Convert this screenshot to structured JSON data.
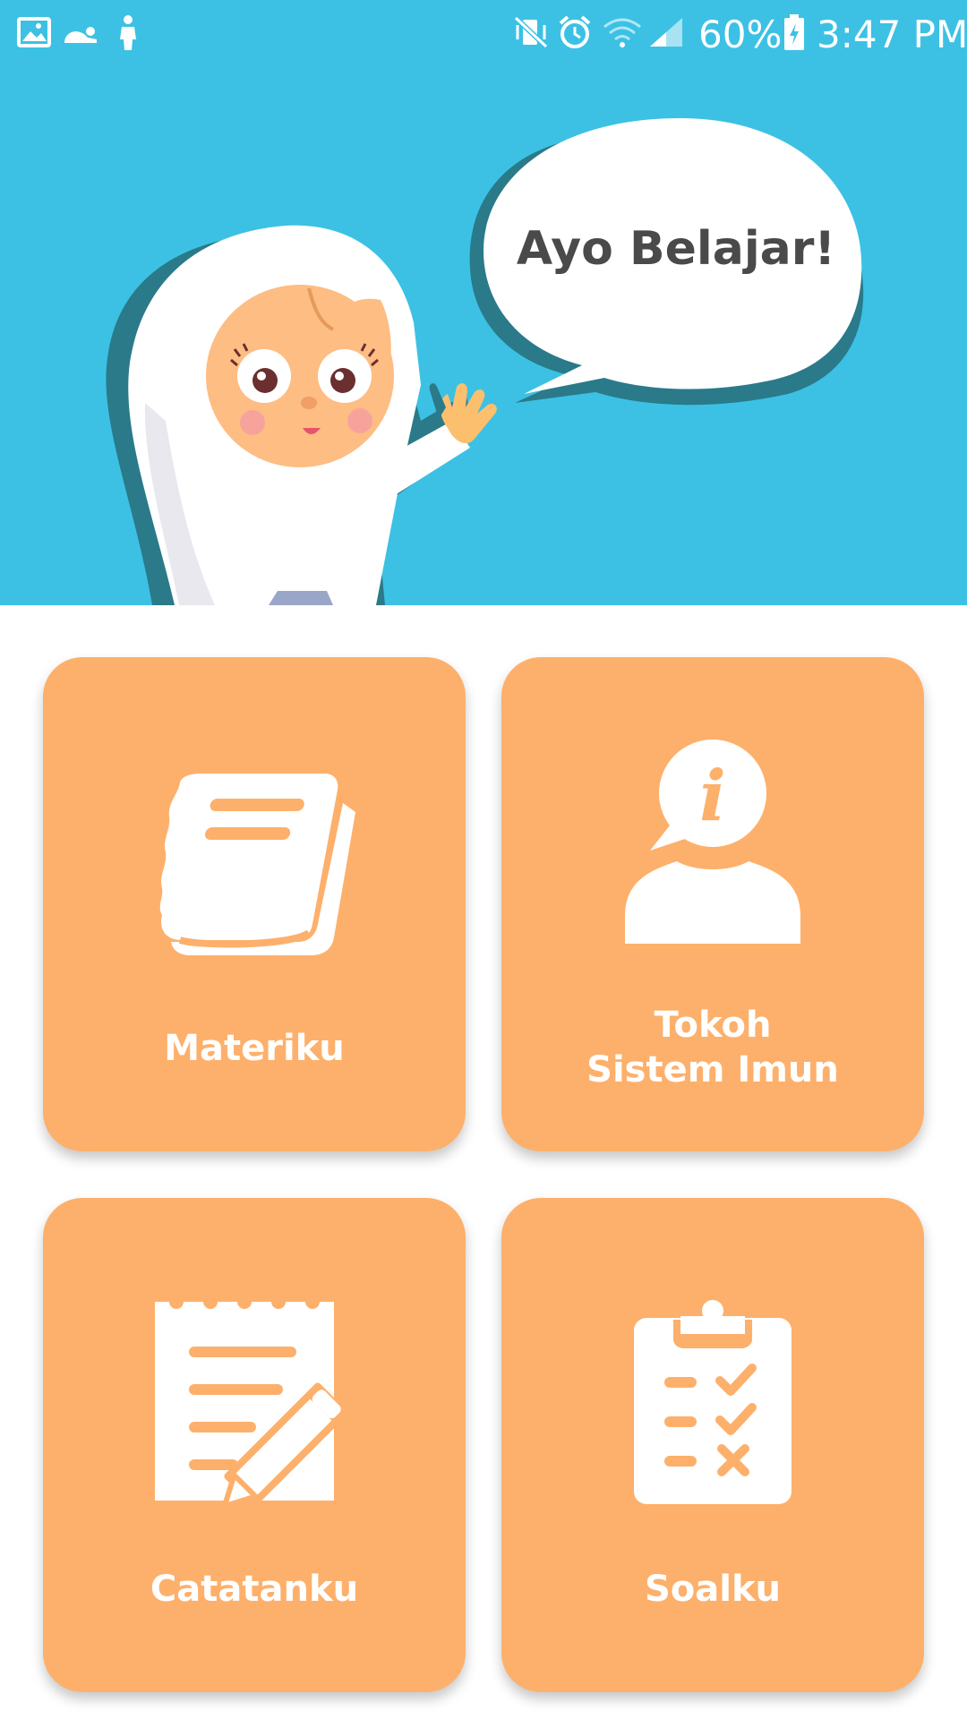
{
  "status_bar": {
    "battery_percent": "60%",
    "time": "3:47 PM",
    "left_icons": [
      "gallery-icon",
      "prayer-icon",
      "person-icon"
    ],
    "right_icons": [
      "mute-vibrate-icon",
      "alarm-icon",
      "wifi-icon",
      "signal-icon",
      "battery-charging-icon"
    ]
  },
  "hero": {
    "speech_bubble": "Ayo Belajar!",
    "background_color": "#3cc1e4"
  },
  "menu": {
    "tile_color": "#fdb06b",
    "items": [
      {
        "id": "materiku",
        "label": "Materiku",
        "icon": "book-icon"
      },
      {
        "id": "tokoh",
        "label_line1": "Tokoh",
        "label_line2": "Sistem Imun",
        "icon": "person-info-icon"
      },
      {
        "id": "catatanku",
        "label": "Catatanku",
        "icon": "notepad-pencil-icon"
      },
      {
        "id": "soalku",
        "label": "Soalku",
        "icon": "clipboard-checklist-icon"
      }
    ]
  }
}
